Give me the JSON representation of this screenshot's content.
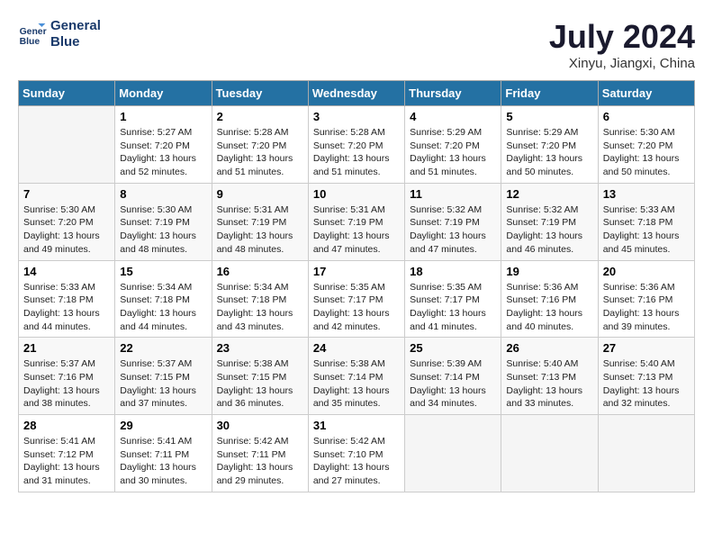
{
  "header": {
    "logo_line1": "General",
    "logo_line2": "Blue",
    "month_title": "July 2024",
    "subtitle": "Xinyu, Jiangxi, China"
  },
  "days_of_week": [
    "Sunday",
    "Monday",
    "Tuesday",
    "Wednesday",
    "Thursday",
    "Friday",
    "Saturday"
  ],
  "weeks": [
    [
      {
        "day": "",
        "info": ""
      },
      {
        "day": "1",
        "info": "Sunrise: 5:27 AM\nSunset: 7:20 PM\nDaylight: 13 hours and 52 minutes."
      },
      {
        "day": "2",
        "info": "Sunrise: 5:28 AM\nSunset: 7:20 PM\nDaylight: 13 hours and 51 minutes."
      },
      {
        "day": "3",
        "info": "Sunrise: 5:28 AM\nSunset: 7:20 PM\nDaylight: 13 hours and 51 minutes."
      },
      {
        "day": "4",
        "info": "Sunrise: 5:29 AM\nSunset: 7:20 PM\nDaylight: 13 hours and 51 minutes."
      },
      {
        "day": "5",
        "info": "Sunrise: 5:29 AM\nSunset: 7:20 PM\nDaylight: 13 hours and 50 minutes."
      },
      {
        "day": "6",
        "info": "Sunrise: 5:30 AM\nSunset: 7:20 PM\nDaylight: 13 hours and 50 minutes."
      }
    ],
    [
      {
        "day": "7",
        "info": "Sunrise: 5:30 AM\nSunset: 7:20 PM\nDaylight: 13 hours and 49 minutes."
      },
      {
        "day": "8",
        "info": "Sunrise: 5:30 AM\nSunset: 7:19 PM\nDaylight: 13 hours and 48 minutes."
      },
      {
        "day": "9",
        "info": "Sunrise: 5:31 AM\nSunset: 7:19 PM\nDaylight: 13 hours and 48 minutes."
      },
      {
        "day": "10",
        "info": "Sunrise: 5:31 AM\nSunset: 7:19 PM\nDaylight: 13 hours and 47 minutes."
      },
      {
        "day": "11",
        "info": "Sunrise: 5:32 AM\nSunset: 7:19 PM\nDaylight: 13 hours and 47 minutes."
      },
      {
        "day": "12",
        "info": "Sunrise: 5:32 AM\nSunset: 7:19 PM\nDaylight: 13 hours and 46 minutes."
      },
      {
        "day": "13",
        "info": "Sunrise: 5:33 AM\nSunset: 7:18 PM\nDaylight: 13 hours and 45 minutes."
      }
    ],
    [
      {
        "day": "14",
        "info": "Sunrise: 5:33 AM\nSunset: 7:18 PM\nDaylight: 13 hours and 44 minutes."
      },
      {
        "day": "15",
        "info": "Sunrise: 5:34 AM\nSunset: 7:18 PM\nDaylight: 13 hours and 44 minutes."
      },
      {
        "day": "16",
        "info": "Sunrise: 5:34 AM\nSunset: 7:18 PM\nDaylight: 13 hours and 43 minutes."
      },
      {
        "day": "17",
        "info": "Sunrise: 5:35 AM\nSunset: 7:17 PM\nDaylight: 13 hours and 42 minutes."
      },
      {
        "day": "18",
        "info": "Sunrise: 5:35 AM\nSunset: 7:17 PM\nDaylight: 13 hours and 41 minutes."
      },
      {
        "day": "19",
        "info": "Sunrise: 5:36 AM\nSunset: 7:16 PM\nDaylight: 13 hours and 40 minutes."
      },
      {
        "day": "20",
        "info": "Sunrise: 5:36 AM\nSunset: 7:16 PM\nDaylight: 13 hours and 39 minutes."
      }
    ],
    [
      {
        "day": "21",
        "info": "Sunrise: 5:37 AM\nSunset: 7:16 PM\nDaylight: 13 hours and 38 minutes."
      },
      {
        "day": "22",
        "info": "Sunrise: 5:37 AM\nSunset: 7:15 PM\nDaylight: 13 hours and 37 minutes."
      },
      {
        "day": "23",
        "info": "Sunrise: 5:38 AM\nSunset: 7:15 PM\nDaylight: 13 hours and 36 minutes."
      },
      {
        "day": "24",
        "info": "Sunrise: 5:38 AM\nSunset: 7:14 PM\nDaylight: 13 hours and 35 minutes."
      },
      {
        "day": "25",
        "info": "Sunrise: 5:39 AM\nSunset: 7:14 PM\nDaylight: 13 hours and 34 minutes."
      },
      {
        "day": "26",
        "info": "Sunrise: 5:40 AM\nSunset: 7:13 PM\nDaylight: 13 hours and 33 minutes."
      },
      {
        "day": "27",
        "info": "Sunrise: 5:40 AM\nSunset: 7:13 PM\nDaylight: 13 hours and 32 minutes."
      }
    ],
    [
      {
        "day": "28",
        "info": "Sunrise: 5:41 AM\nSunset: 7:12 PM\nDaylight: 13 hours and 31 minutes."
      },
      {
        "day": "29",
        "info": "Sunrise: 5:41 AM\nSunset: 7:11 PM\nDaylight: 13 hours and 30 minutes."
      },
      {
        "day": "30",
        "info": "Sunrise: 5:42 AM\nSunset: 7:11 PM\nDaylight: 13 hours and 29 minutes."
      },
      {
        "day": "31",
        "info": "Sunrise: 5:42 AM\nSunset: 7:10 PM\nDaylight: 13 hours and 27 minutes."
      },
      {
        "day": "",
        "info": ""
      },
      {
        "day": "",
        "info": ""
      },
      {
        "day": "",
        "info": ""
      }
    ]
  ]
}
